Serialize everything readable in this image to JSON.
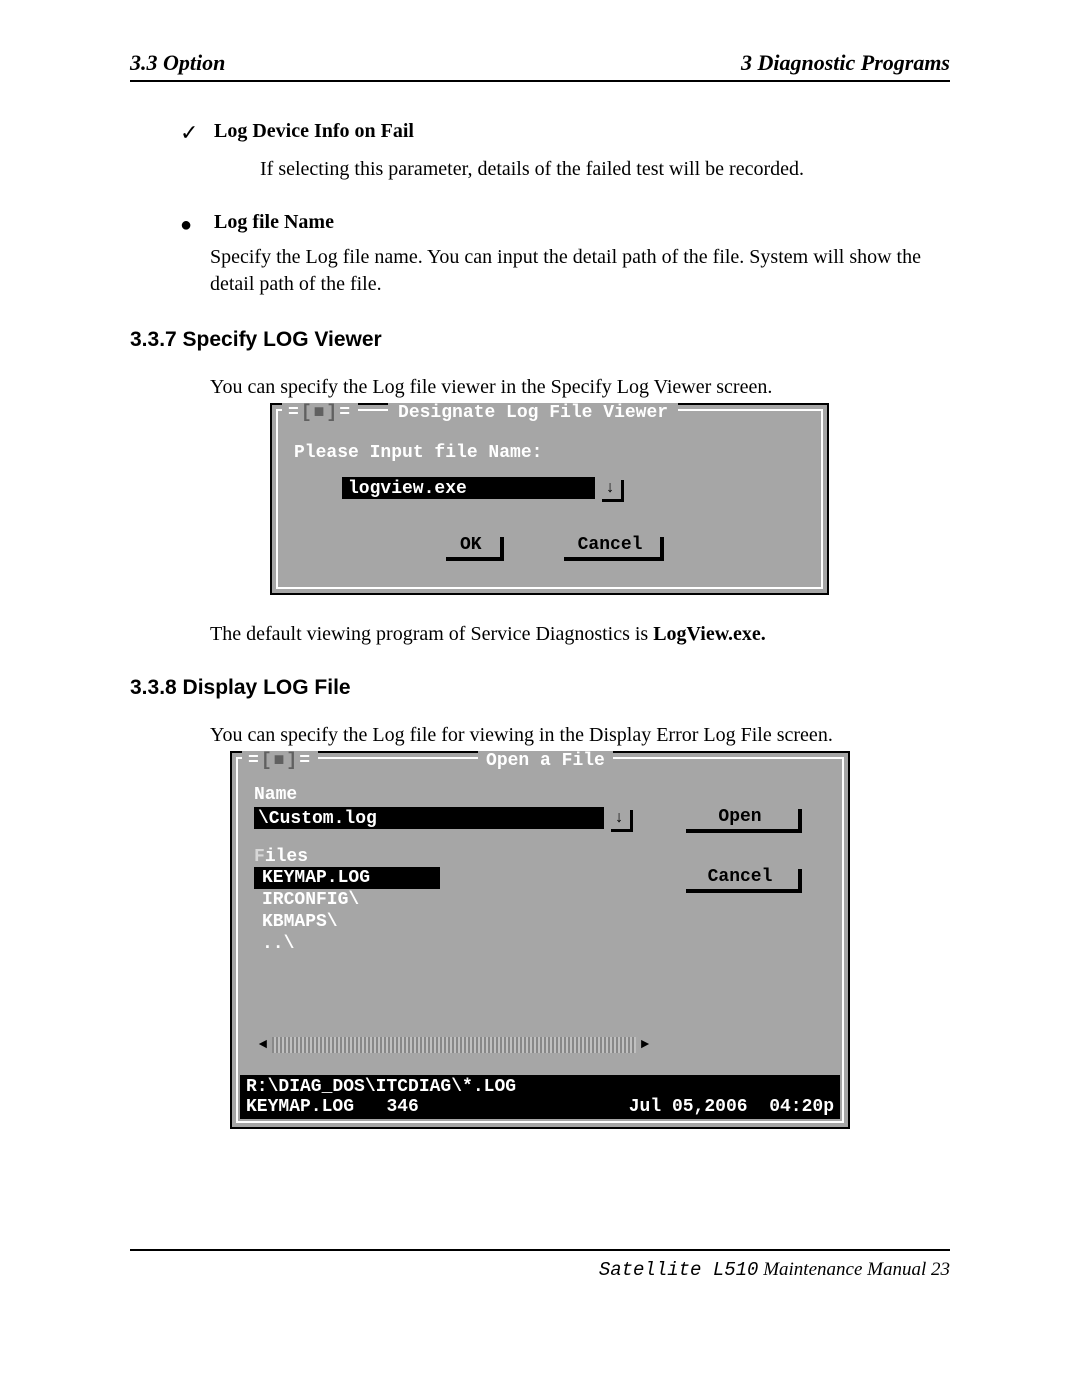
{
  "header": {
    "left": "3.3 Option",
    "right": "3  Diagnostic Programs"
  },
  "item1": {
    "title": "Log Device Info on Fail",
    "body": "If selecting this parameter, details of the failed test will be recorded."
  },
  "item2": {
    "title": "Log file Name",
    "body": "Specify the Log file name. You can input the detail path of the file. System will show the detail path of the file."
  },
  "section337": {
    "heading": "3.3.7  Specify LOG Viewer",
    "intro": "You can specify the Log file viewer in the Specify Log Viewer screen.",
    "dialog": {
      "close_glyph": "[■]",
      "title": "Designate Log File Viewer",
      "prompt": "Please Input file Name:",
      "input_value": "logview.exe",
      "arrow_glyph": "↓",
      "ok": "OK",
      "cancel": "Cancel"
    },
    "caption_prefix": "The default viewing program of Service Diagnostics is ",
    "caption_bold": "LogView.exe."
  },
  "section338": {
    "heading": "3.3.8  Display LOG File",
    "intro": "You can specify the Log file for viewing in the Display Error Log File screen.",
    "dialog": {
      "close_glyph": "[■]",
      "title": "Open a File",
      "name_label": "Name",
      "name_value": "\\Custom.log",
      "arrow_glyph": "↓",
      "open": "Open",
      "cancel": "Cancel",
      "files_hot": "F",
      "files_rest": "iles",
      "file_list": [
        "KEYMAP.LOG",
        "IRCONFIG\\",
        "KBMAPS\\",
        "..\\"
      ],
      "scroll_left": "◄",
      "scroll_right": "►",
      "footer1": "R:\\DIAG_DOS\\ITCDIAG\\*.LOG",
      "footer2_name": "KEYMAP.LOG",
      "footer2_size": "346",
      "footer2_date": "Jul 05,2006",
      "footer2_time": "04:20p"
    }
  },
  "footer": {
    "model": "Satellite L510",
    "text": " Maintenance Manual",
    "page": " 23"
  }
}
